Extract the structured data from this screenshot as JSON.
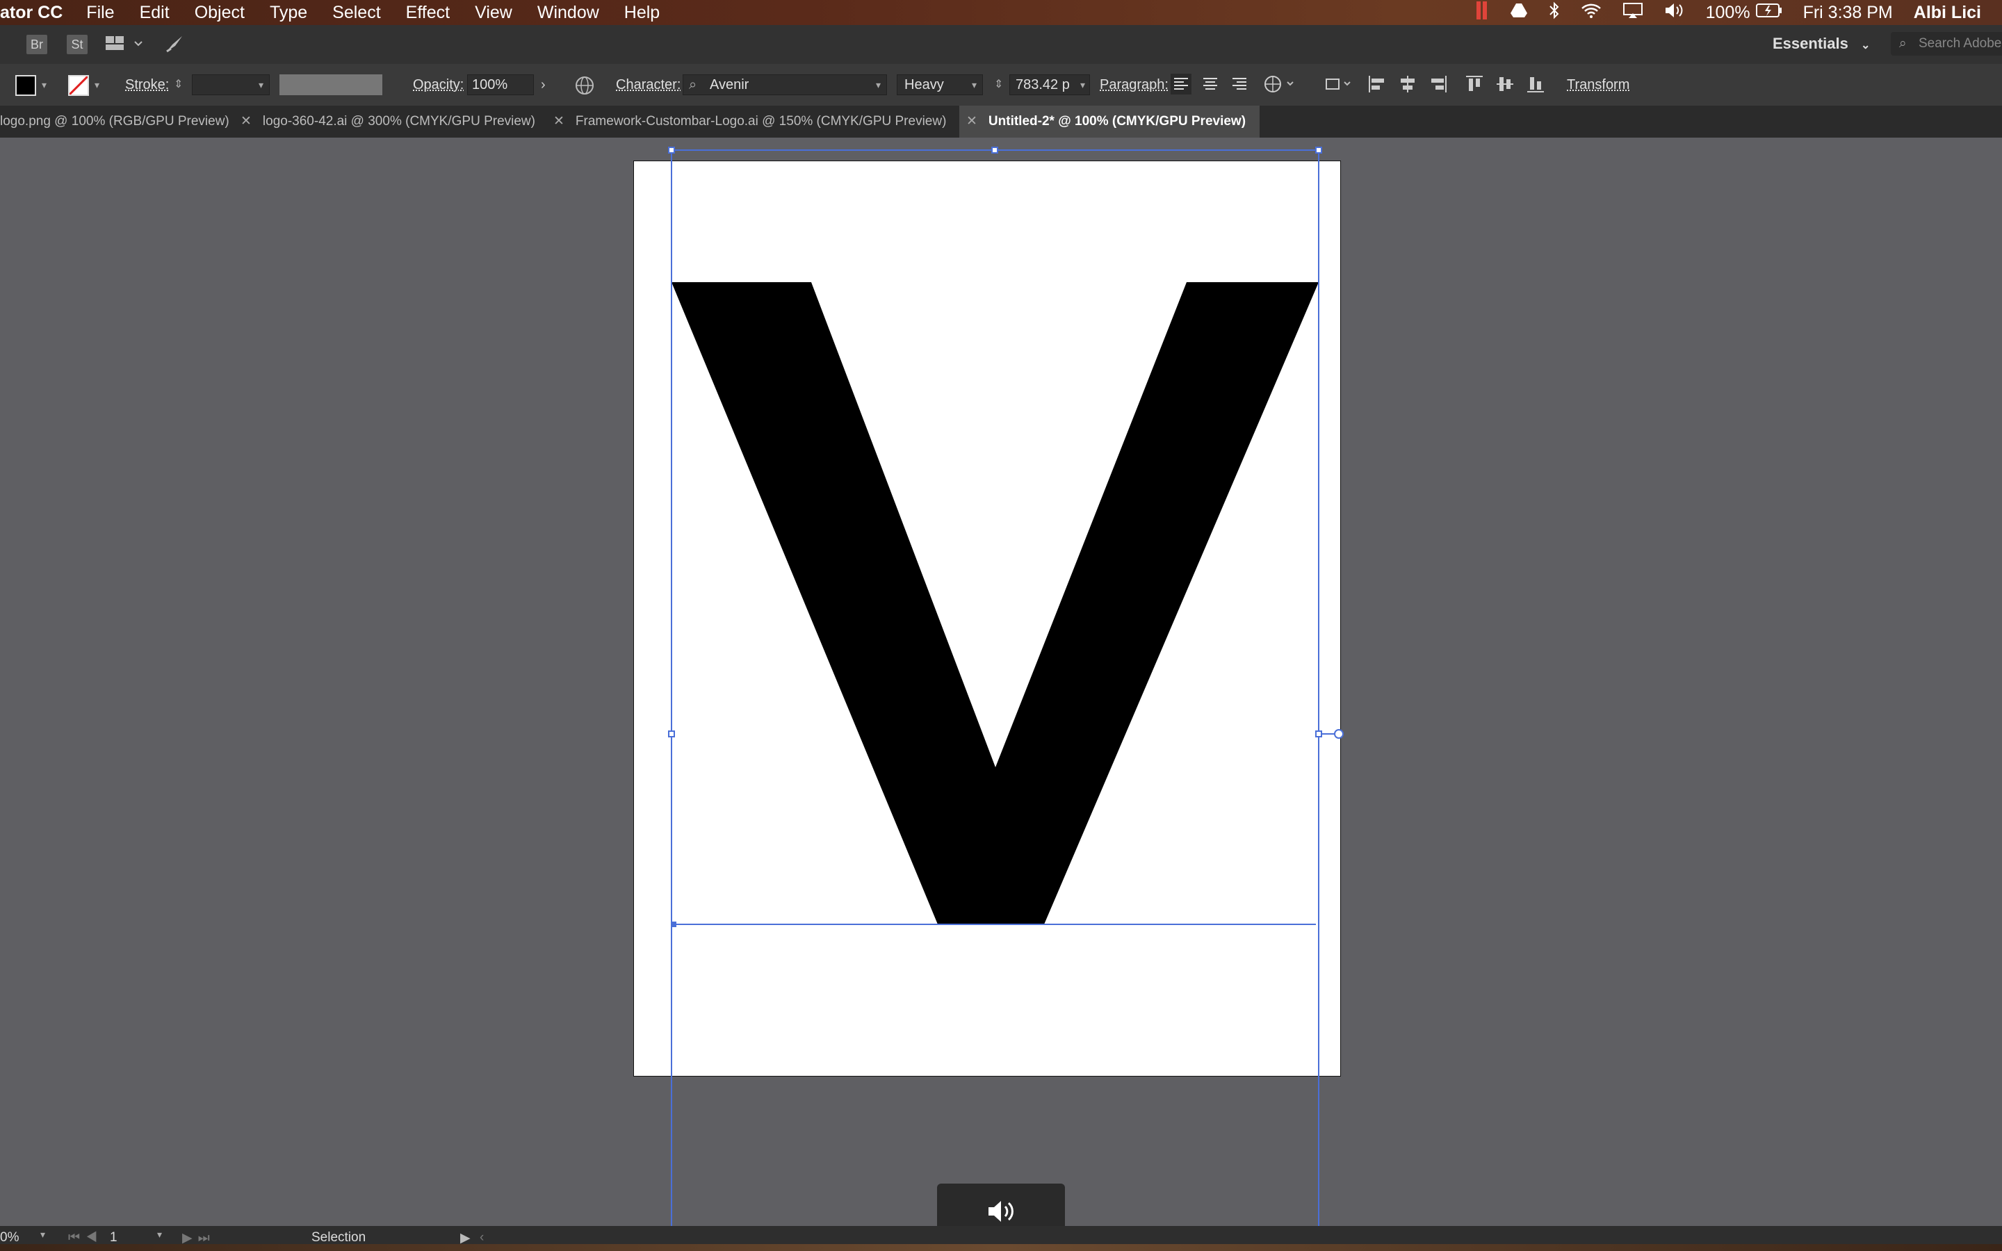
{
  "menubar": {
    "app": "ator CC",
    "menus": [
      "File",
      "Edit",
      "Object",
      "Type",
      "Select",
      "Effect",
      "View",
      "Window",
      "Help"
    ],
    "battery": "100%",
    "clock": "Fri 3:38 PM",
    "user": "Albi Lici"
  },
  "appbar": {
    "bridge": "Br",
    "stock": "St",
    "workspace": "Essentials",
    "search_placeholder": "Search Adobe"
  },
  "control": {
    "stroke_label": "Stroke:",
    "opacity_label": "Opacity:",
    "opacity_value": "100%",
    "character_label": "Character:",
    "font_family": "Avenir",
    "font_style": "Heavy",
    "font_size": "783.42 p",
    "paragraph_label": "Paragraph:",
    "transform_label": "Transform"
  },
  "tabs": [
    {
      "label": "logo.png @ 100% (RGB/GPU Preview)",
      "active": false
    },
    {
      "label": "logo-360-42.ai @ 300% (CMYK/GPU Preview)",
      "active": false
    },
    {
      "label": "Framework-Custombar-Logo.ai @ 150% (CMYK/GPU Preview)",
      "active": false
    },
    {
      "label": "Untitled-2* @ 100% (CMYK/GPU Preview)",
      "active": true
    }
  ],
  "status": {
    "zoom": "0%",
    "artboard_number": "1",
    "tool": "Selection"
  },
  "colors": {
    "canvas_bg": "#5f5f63",
    "selection_blue": "#4a6fd8",
    "menubar": "#4a2416"
  },
  "icons": [
    "speaker-icon",
    "wifi-icon",
    "bluetooth-icon",
    "drive-icon",
    "volume-icon",
    "airplay-icon",
    "battery-icon",
    "search-icon",
    "globe-icon",
    "brush-icon",
    "layout-icon"
  ]
}
